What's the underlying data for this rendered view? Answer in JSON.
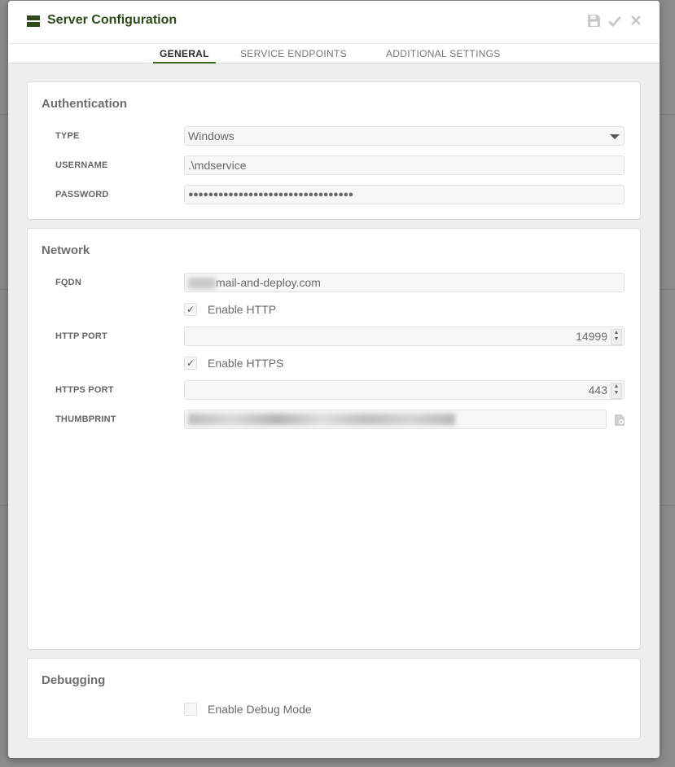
{
  "dialog": {
    "title": "Server Configuration",
    "actions": [
      {
        "name": "save-icon",
        "glyph": "💾"
      },
      {
        "name": "confirm-icon",
        "glyph": "✔"
      },
      {
        "name": "close-icon",
        "glyph": "✕"
      }
    ]
  },
  "tabs": [
    {
      "label": "GENERAL",
      "active": true
    },
    {
      "label": "SERVICE ENDPOINTS",
      "active": false
    },
    {
      "label": "ADDITIONAL SETTINGS",
      "active": false
    }
  ],
  "authentication": {
    "title": "Authentication",
    "type_label": "TYPE",
    "type_value": "Windows",
    "username_label": "USERNAME",
    "username_value": ".\\mdservice",
    "password_label": "PASSWORD",
    "password_value": "●●●●●●●●●●●●●●●●●●●●●●●●●●●●●●●●●"
  },
  "network": {
    "title": "Network",
    "fqdn_label": "FQDN",
    "fqdn_value_suffix": "mail-and-deploy.com",
    "enable_http_label": "Enable HTTP",
    "enable_http_checked": true,
    "http_port_label": "HTTP PORT",
    "http_port_value": "14999",
    "enable_https_label": "Enable HTTPS",
    "enable_https_checked": true,
    "https_port_label": "HTTPS PORT",
    "https_port_value": "443",
    "thumbprint_label": "THUMBPRINT"
  },
  "debugging": {
    "title": "Debugging",
    "enable_debug_label": "Enable Debug Mode",
    "enable_debug_checked": false
  },
  "colors": {
    "accent": "#2e4a1b",
    "tab_underline": "#3e6a23"
  }
}
